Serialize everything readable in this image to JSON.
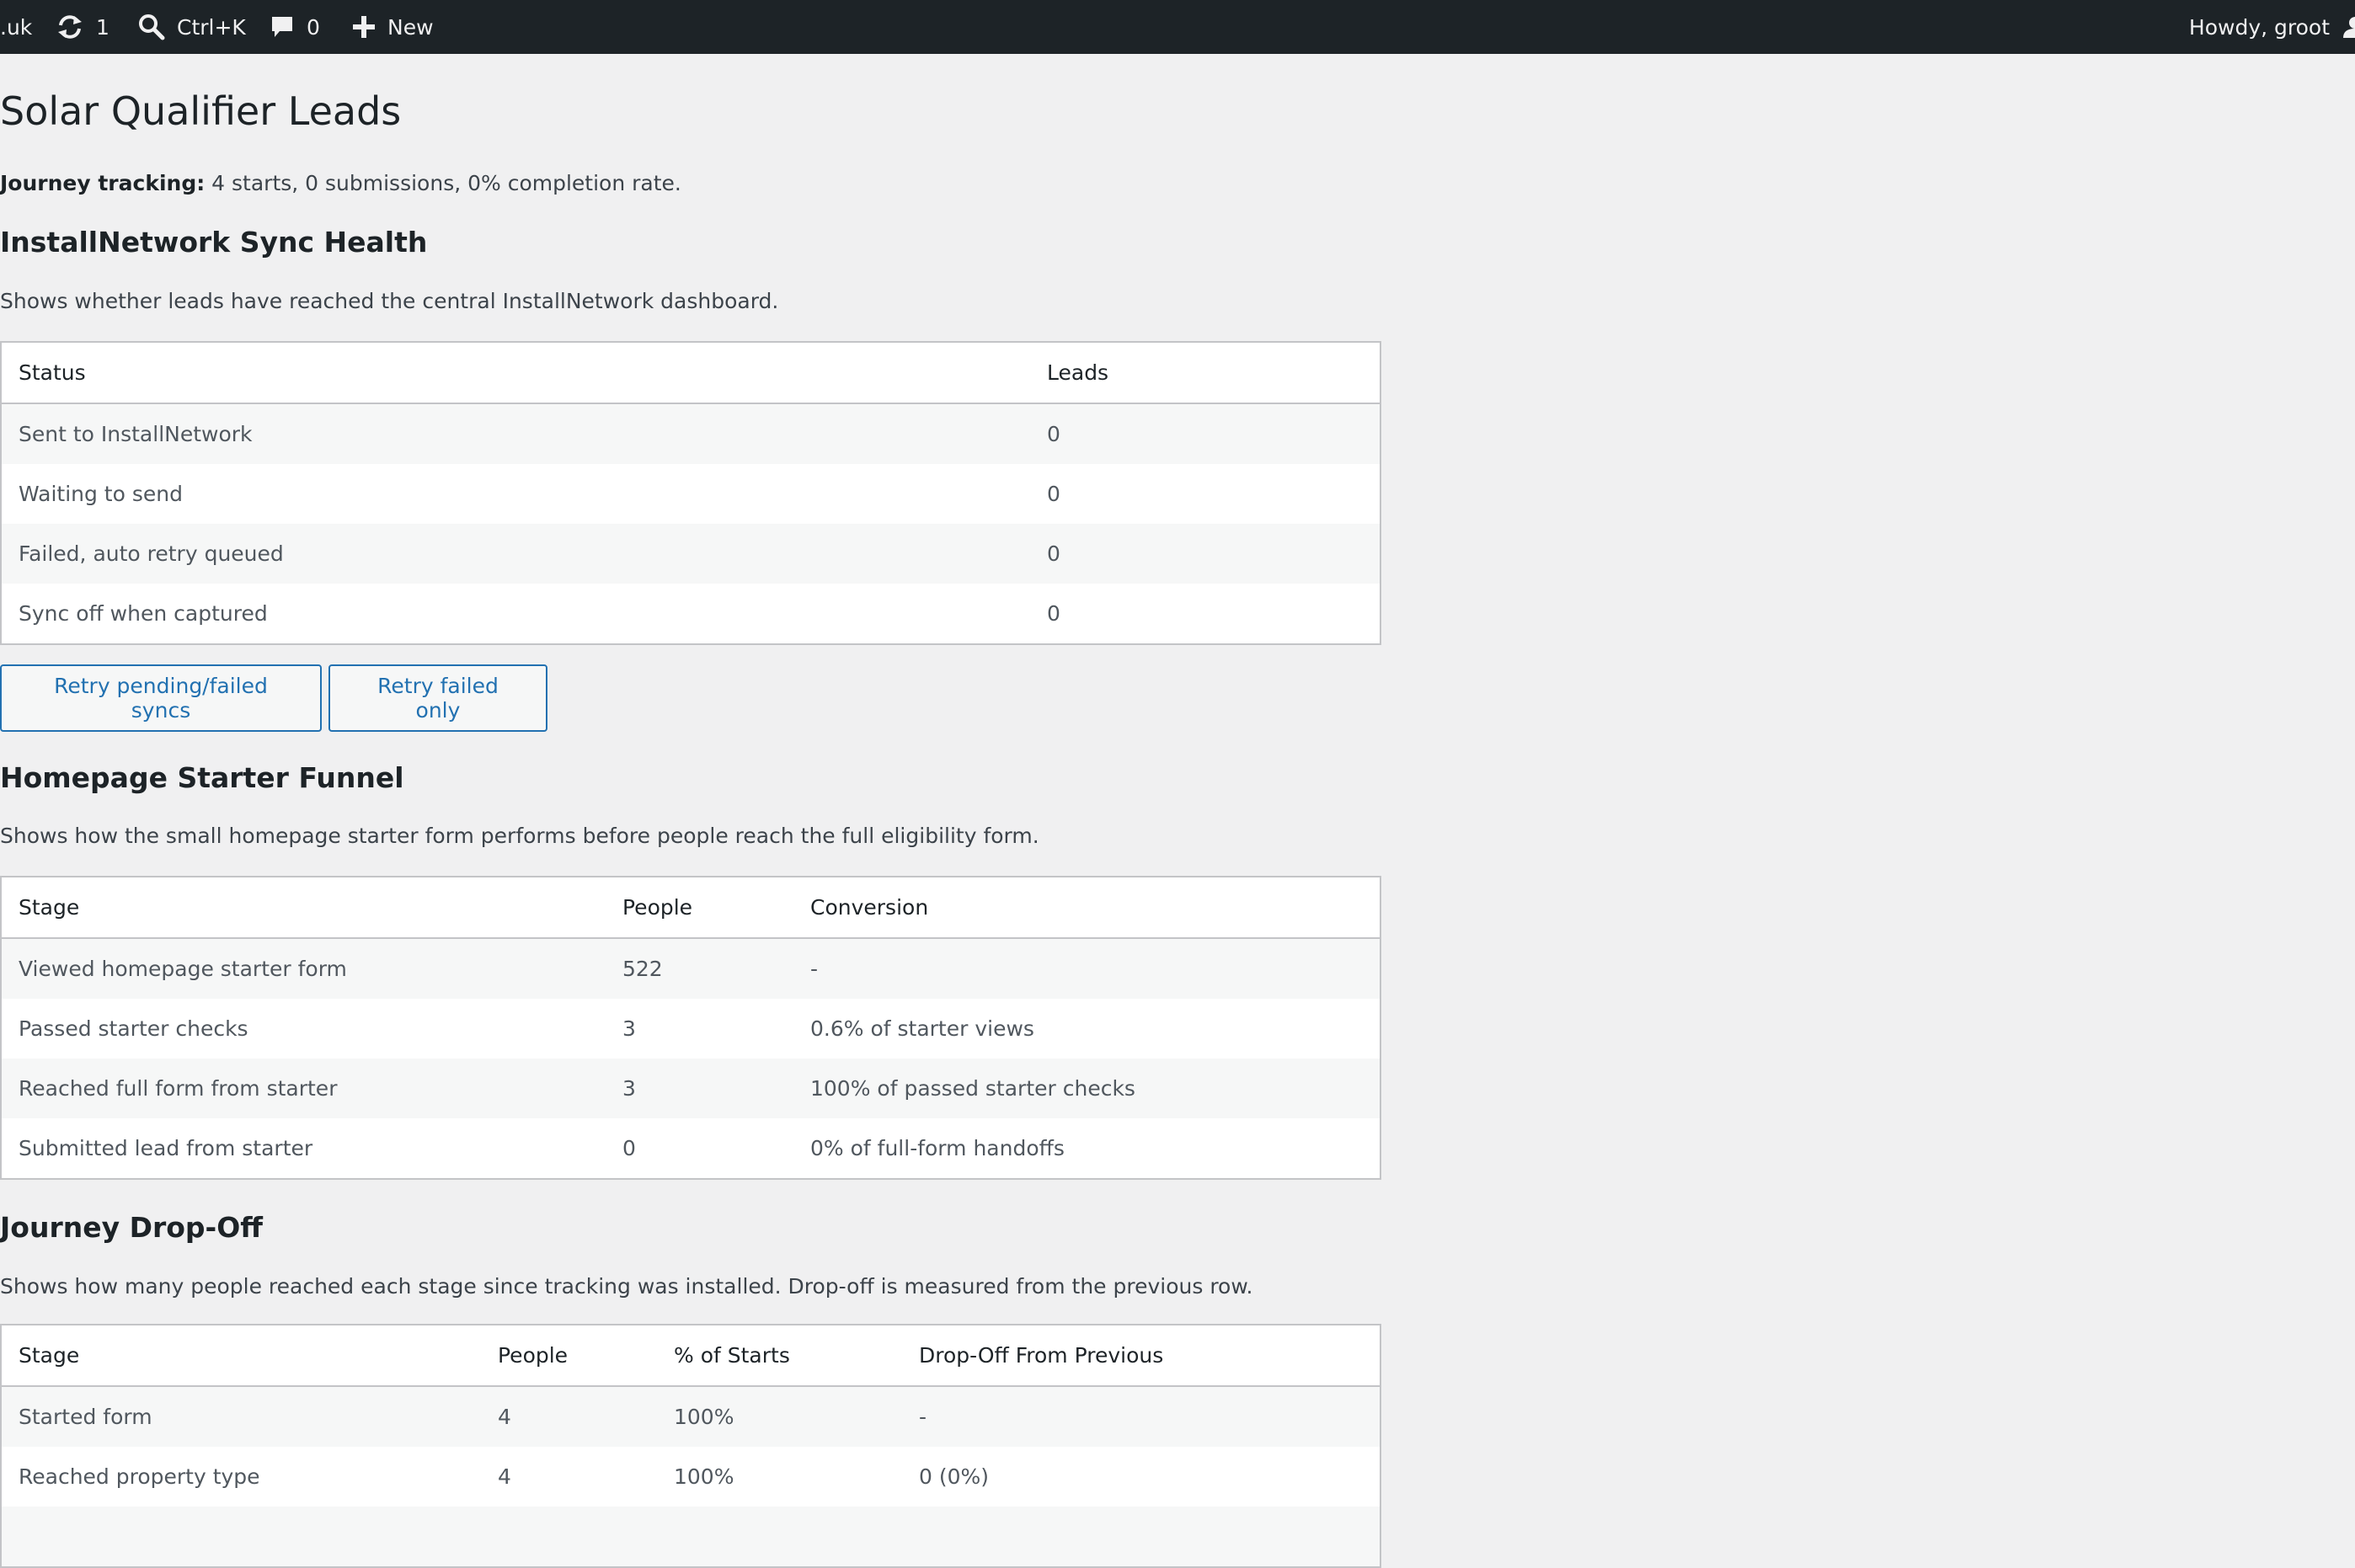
{
  "adminbar": {
    "site": ".uk",
    "updates_count": "1",
    "search_shortcut": "Ctrl+K",
    "comments_count": "0",
    "new_label": "New",
    "howdy": "Howdy, groot"
  },
  "page": {
    "title": "Solar Qualifier Leads",
    "tracking_label": "Journey tracking:",
    "tracking_text": "4 starts, 0 submissions, 0% completion rate."
  },
  "sync": {
    "heading": "InstallNetwork Sync Health",
    "description": "Shows whether leads have reached the central InstallNetwork dashboard.",
    "columns": [
      "Status",
      "Leads"
    ],
    "rows": [
      [
        "Sent to InstallNetwork",
        "0"
      ],
      [
        "Waiting to send",
        "0"
      ],
      [
        "Failed, auto retry queued",
        "0"
      ],
      [
        "Sync off when captured",
        "0"
      ]
    ],
    "retry_all_label": "Retry pending/failed syncs",
    "retry_failed_label": "Retry failed only"
  },
  "funnel": {
    "heading": "Homepage Starter Funnel",
    "description": "Shows how the small homepage starter form performs before people reach the full eligibility form.",
    "columns": [
      "Stage",
      "People",
      "Conversion"
    ],
    "rows": [
      [
        "Viewed homepage starter form",
        "522",
        "-"
      ],
      [
        "Passed starter checks",
        "3",
        "0.6% of starter views"
      ],
      [
        "Reached full form from starter",
        "3",
        "100% of passed starter checks"
      ],
      [
        "Submitted lead from starter",
        "0",
        "0% of full-form handoffs"
      ]
    ]
  },
  "dropoff": {
    "heading": "Journey Drop-Off",
    "description": "Shows how many people reached each stage since tracking was installed. Drop-off is measured from the previous row.",
    "columns": [
      "Stage",
      "People",
      "% of Starts",
      "Drop-Off From Previous"
    ],
    "rows": [
      [
        "Started form",
        "4",
        "100%",
        "-"
      ],
      [
        "Reached property type",
        "4",
        "100%",
        "0 (0%)"
      ],
      [
        "",
        "",
        "",
        ""
      ]
    ]
  }
}
